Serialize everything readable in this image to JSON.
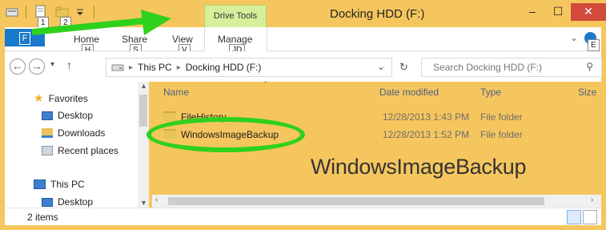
{
  "titlebar": {
    "window_title": "Docking HDD (F:)",
    "context_tab": "Drive Tools",
    "qat_keytips": [
      "1",
      "2"
    ],
    "minimize_glyph": "–",
    "maximize_glyph": "☐",
    "close_glyph": "✕"
  },
  "ribbon": {
    "file_label": "F",
    "tabs": [
      {
        "label": "Home",
        "keytip": "H"
      },
      {
        "label": "Share",
        "keytip": "S"
      },
      {
        "label": "View",
        "keytip": "V"
      },
      {
        "label": "Manage",
        "keytip": "JD"
      }
    ],
    "help_keytip": "E",
    "expand_glyph": "⌄"
  },
  "navigation": {
    "back_glyph": "←",
    "forward_glyph": "→",
    "recent_glyph": "▾",
    "up_glyph": "↑",
    "breadcrumb": [
      "This PC",
      "Docking HDD (F:)"
    ],
    "breadcrumb_sep": "▸",
    "dropdown_glyph": "⌄",
    "refresh_glyph": "↻",
    "search_placeholder": "Search Docking HDD (F:)",
    "search_glyph": "⚲"
  },
  "nav_pane": {
    "favorites_label": "Favorites",
    "favorites_items": [
      "Desktop",
      "Downloads",
      "Recent places"
    ],
    "thispc_label": "This PC",
    "thispc_items": [
      "Desktop"
    ]
  },
  "file_list": {
    "columns": [
      "Name",
      "Date modified",
      "Type",
      "Size"
    ],
    "rows": [
      {
        "name": "FileHistory",
        "date": "12/28/2013 1:43 PM",
        "type": "File folder"
      },
      {
        "name": "WindowsImageBackup",
        "date": "12/28/2013 1:52 PM",
        "type": "File folder"
      }
    ],
    "callout_label": "WindowsImageBackup"
  },
  "status_bar": {
    "item_count": "2 items"
  },
  "colors": {
    "title_bg": "#f6c65e",
    "accent_blue": "#1979ca",
    "annotation_green": "#2ed11b",
    "drive_tools_bg": "#d7ee9b"
  }
}
